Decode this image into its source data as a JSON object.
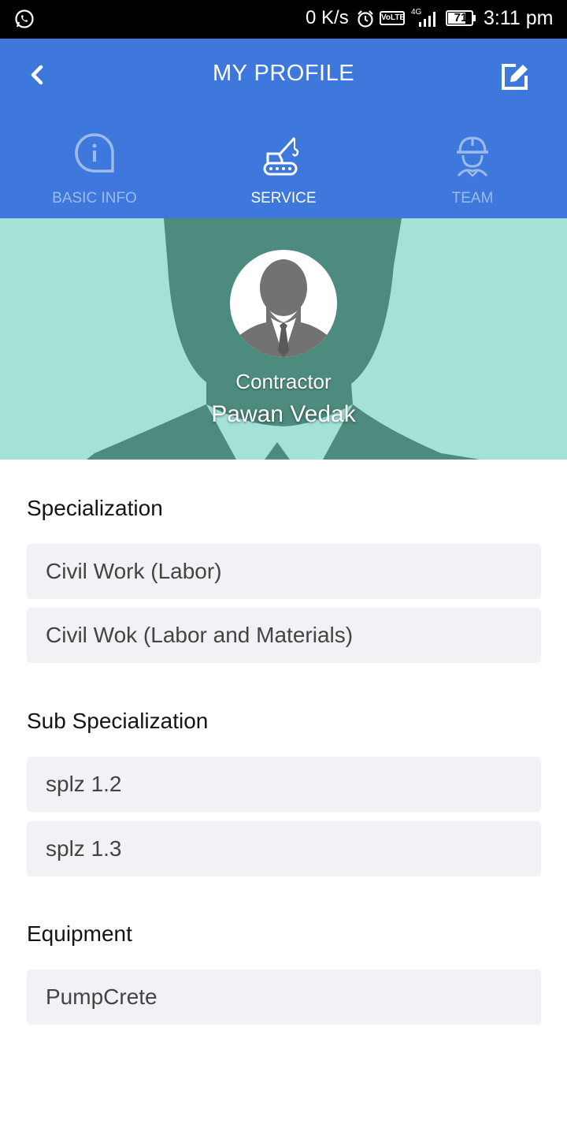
{
  "status_bar": {
    "net_speed": "0 K/s",
    "volte": "VoLTE",
    "network": "4G",
    "battery": "71",
    "time": "3:11 pm"
  },
  "header": {
    "title": "MY PROFILE",
    "back_icon": "chevron-left-icon",
    "edit_icon": "edit-icon",
    "background": "#3f78dc"
  },
  "tabs": [
    {
      "label": "BASIC INFO",
      "icon": "info-icon",
      "active": false
    },
    {
      "label": "SERVICE",
      "icon": "crane-icon",
      "active": true
    },
    {
      "label": "TEAM",
      "icon": "worker-helmet-icon",
      "active": false
    }
  ],
  "profile": {
    "role": "Contractor",
    "name": "Pawan Vedak"
  },
  "sections": {
    "specialization": {
      "title": "Specialization",
      "items": [
        "Civil Work (Labor)",
        "Civil Wok (Labor and Materials)"
      ]
    },
    "sub_specialization": {
      "title": "Sub Specialization",
      "items": [
        "splz 1.2",
        "splz 1.3"
      ]
    },
    "equipment": {
      "title": "Equipment",
      "items": [
        "PumpCrete"
      ]
    }
  }
}
